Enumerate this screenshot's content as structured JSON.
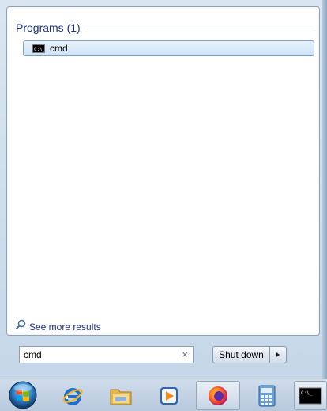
{
  "results": {
    "group_title": "Programs (1)",
    "items": [
      {
        "label": "cmd",
        "icon": "command-prompt-icon"
      }
    ]
  },
  "see_more": {
    "label": "See more results",
    "icon": "search-icon"
  },
  "search": {
    "value": "cmd",
    "clear_icon": "×"
  },
  "shutdown": {
    "label": "Shut down",
    "arrow_icon": "▸"
  },
  "taskbar": {
    "items": [
      "start-orb-icon",
      "internet-explorer-icon",
      "file-explorer-icon",
      "media-player-icon",
      "firefox-icon",
      "calculator-icon",
      "command-prompt-icon"
    ],
    "cmd_thumbnail_text": "C:\\_"
  },
  "colors": {
    "group_title": "#1e3287",
    "link": "#1e3287",
    "selection_border": "#7da2ce",
    "selection_fill": "#d9eaf9"
  }
}
